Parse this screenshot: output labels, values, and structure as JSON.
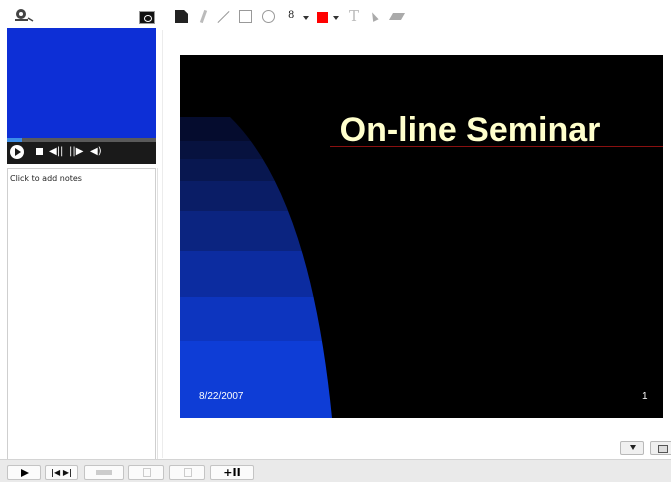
{
  "left_panel": {
    "webcam_icon": "webcam-icon",
    "snapshot_icon": "camera-icon",
    "video_background": "#0d2fd6",
    "video_progress": 0.1,
    "controls": {
      "play_icon": "play-icon",
      "stop_icon": "stop-icon",
      "step_back_glyph": "◀||",
      "step_forward_glyph": "||▶",
      "volume_glyph": "◀)"
    },
    "notes_placeholder": "Click to add notes"
  },
  "draw_toolbar": {
    "pen_size": "8",
    "text_tool_glyph": "T",
    "pen_color": "#ff0000",
    "tools": [
      "page-icon",
      "pen-icon",
      "line-icon",
      "rectangle-icon",
      "ellipse-icon",
      "text-icon",
      "pointer-icon",
      "eraser-icon"
    ]
  },
  "slide": {
    "title": "On-line Seminar",
    "date": "8/22/2007",
    "number": "1",
    "title_color": "#ffffcc",
    "background": "#000000"
  },
  "bottom_bar": {
    "prev_next_label": "|◀ ▶|",
    "add_label": "+II"
  }
}
